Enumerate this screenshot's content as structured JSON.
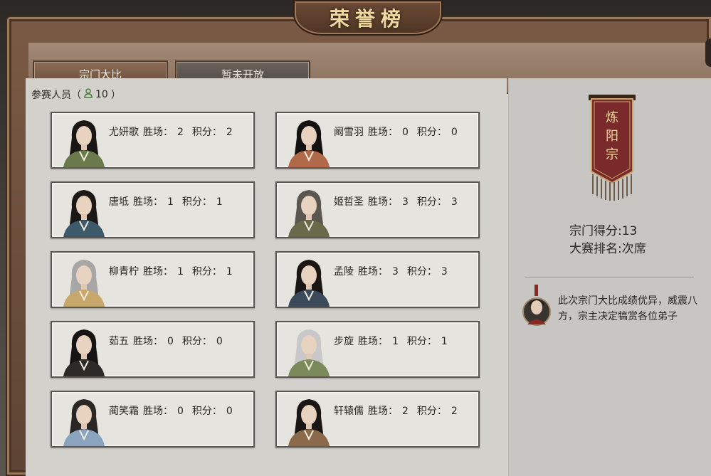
{
  "title": "荣誉榜",
  "tabs": [
    {
      "label": "宗门大比",
      "active": true
    },
    {
      "label": "暂未开放",
      "active": false
    }
  ],
  "participants": {
    "label": "参赛人员（",
    "count": "10",
    "close_paren": "）"
  },
  "stat_labels": {
    "wins": "胜场：",
    "points": "积分："
  },
  "members": [
    {
      "name": "尤妍歌",
      "wins": "2",
      "points": "2"
    },
    {
      "name": "阚雪羽",
      "wins": "0",
      "points": "0"
    },
    {
      "name": "唐坻",
      "wins": "1",
      "points": "1"
    },
    {
      "name": "姬哲圣",
      "wins": "3",
      "points": "3"
    },
    {
      "name": "柳青柠",
      "wins": "1",
      "points": "1"
    },
    {
      "name": "孟陵",
      "wins": "3",
      "points": "3"
    },
    {
      "name": "茹五",
      "wins": "0",
      "points": "0"
    },
    {
      "name": "步旋",
      "wins": "1",
      "points": "1"
    },
    {
      "name": "蔺笑霜",
      "wins": "0",
      "points": "0"
    },
    {
      "name": "轩辕儒",
      "wins": "2",
      "points": "2"
    }
  ],
  "sect": {
    "banner_lines": [
      "炼",
      "阳",
      "宗"
    ],
    "score_label": "宗门得分:",
    "score": "13",
    "rank_label": "大赛排名:",
    "rank": "次席"
  },
  "master_message": "此次宗门大比成绩优异，威震八方，宗主决定犒赏各位弟子",
  "colors": {
    "frame_brown": "#6b4a36",
    "gold_text": "#f0d9a0",
    "banner_red": "#7a2a2a"
  }
}
